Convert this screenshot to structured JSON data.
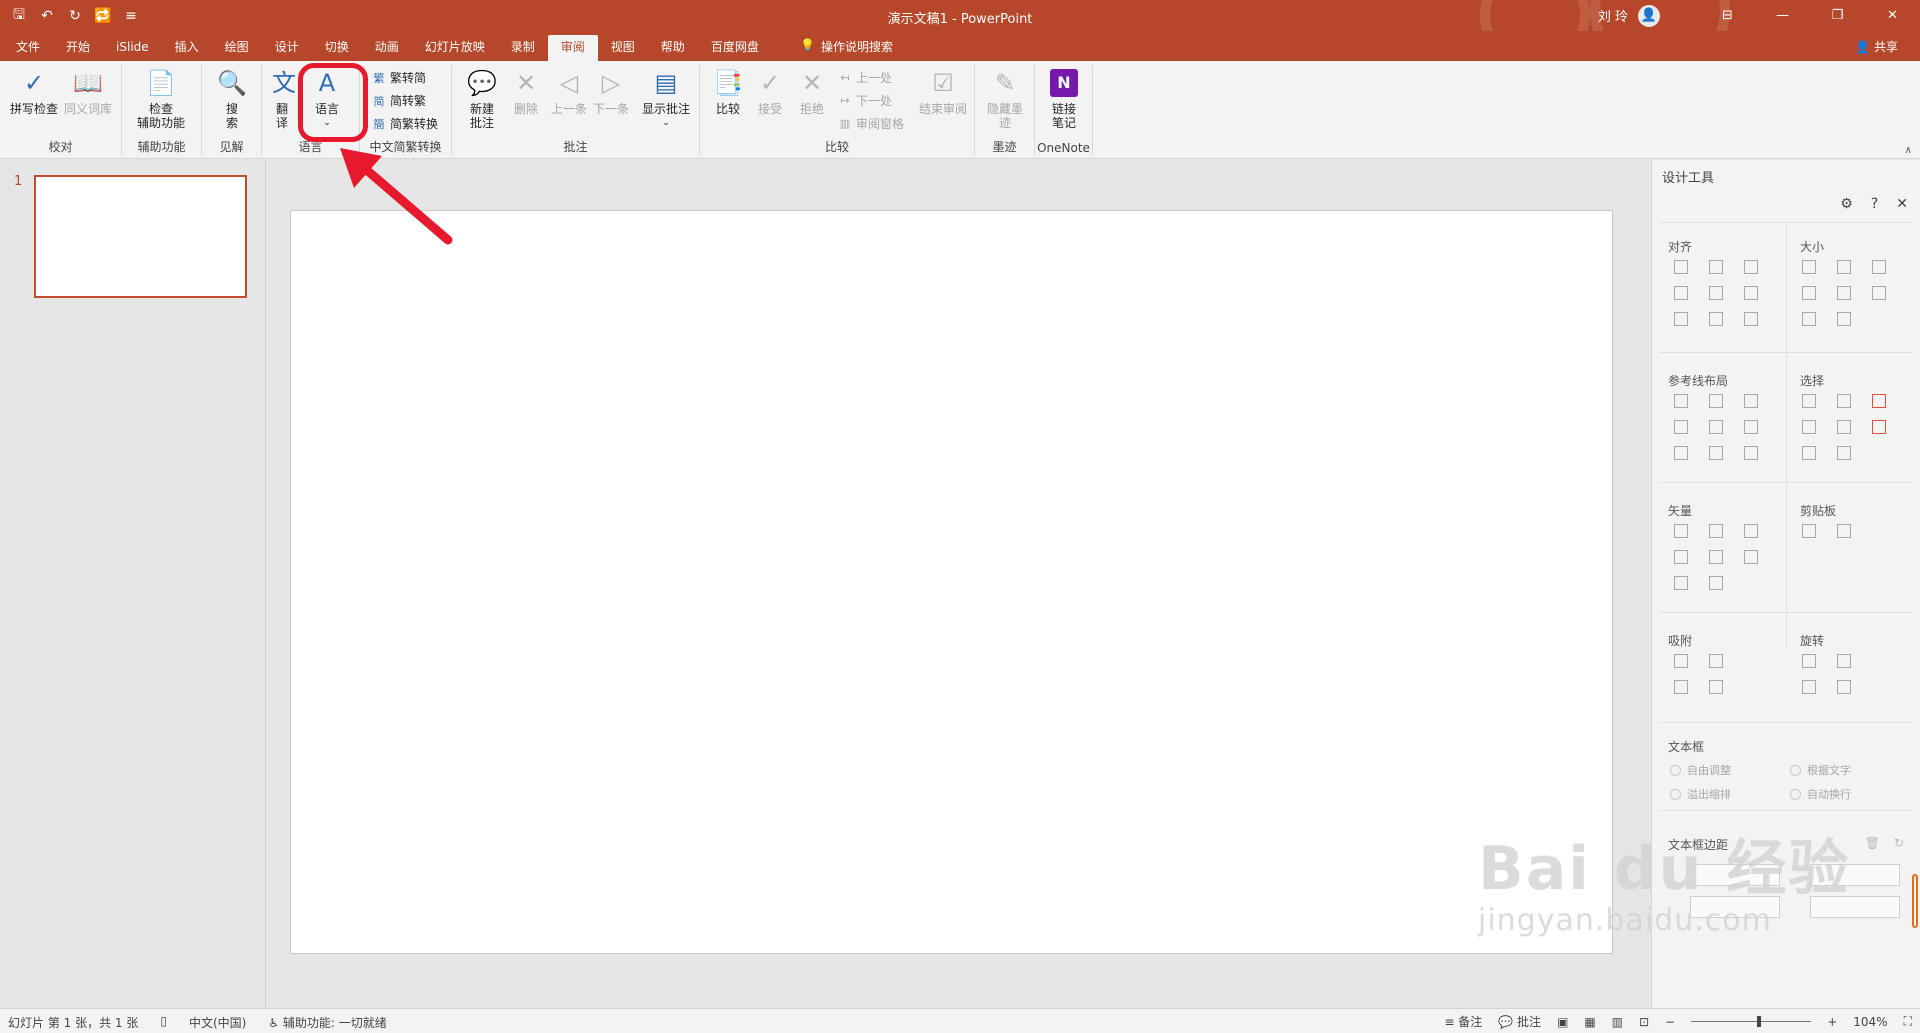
{
  "titlebar": {
    "title": "演示文稿1  -  PowerPoint",
    "user_name": "刘 玲",
    "qat": {
      "save": "🖫",
      "undo": "↶",
      "redo": "↻",
      "repeat": "🔁",
      "more": "≡"
    },
    "window": {
      "ribbon_display": "⊟",
      "minimize": "—",
      "restore": "❐",
      "close": "✕"
    }
  },
  "tabs": [
    "文件",
    "开始",
    "iSlide",
    "插入",
    "绘图",
    "设计",
    "切换",
    "动画",
    "幻灯片放映",
    "录制",
    "审阅",
    "视图",
    "帮助",
    "百度网盘"
  ],
  "active_tab": "审阅",
  "tell_me": "操作说明搜索",
  "share": "共享",
  "ribbon": {
    "proofing": {
      "label": "校对",
      "spell": "拼写检查",
      "thesaurus": "同义词库"
    },
    "accessibility": {
      "label": "辅助功能",
      "check_line1": "检查",
      "check_line2": "辅助功能"
    },
    "insights": {
      "label": "见解",
      "search_line1": "搜",
      "search_line2": "索"
    },
    "language": {
      "label": "语言",
      "translate_line1": "翻",
      "translate_line2": "译",
      "language_btn": "语言"
    },
    "chinese": {
      "label": "中文简繁转换",
      "t2s": "繁转简",
      "s2t": "简转繁",
      "convert": "简繁转换"
    },
    "comments": {
      "label": "批注",
      "new_line1": "新建",
      "new_line2": "批注",
      "delete": "删除",
      "prev": "上一条",
      "next": "下一条",
      "show": "显示批注"
    },
    "compare": {
      "label": "比较",
      "compare": "比较",
      "accept": "接受",
      "reject": "拒绝",
      "prev": "上一处",
      "next": "下一处",
      "pane": "审阅窗格",
      "end": "结束审阅"
    },
    "ink": {
      "label": "墨迹",
      "hide_line1": "隐藏墨",
      "hide_line2": "迹"
    },
    "onenote": {
      "label": "OneNote",
      "link_line1": "链接",
      "link_line2": "笔记"
    }
  },
  "thumb_number": "1",
  "design_pane": {
    "title": "设计工具",
    "sections": {
      "align": "对齐",
      "size": "大小",
      "guides": "参考线布局",
      "select": "选择",
      "vector": "矢量",
      "clipboard": "剪贴板",
      "snap": "吸附",
      "rotate": "旋转",
      "textbox": "文本框",
      "margin": "文本框边距"
    },
    "textbox_options": [
      "自由调整",
      "根据文字",
      "溢出缩排",
      "自动换行"
    ]
  },
  "status": {
    "slide": "幻灯片 第 1 张，共 1 张",
    "lang": "中文(中国)",
    "accessibility": "辅助功能: 一切就绪",
    "notes": "备注",
    "comments": "批注",
    "zoom": "104%"
  },
  "watermark": {
    "main": "Bai du 经验",
    "sub": "jingyan.baidu.com"
  },
  "colors": {
    "accent": "#b7472a",
    "highlight": "#e8192c"
  }
}
